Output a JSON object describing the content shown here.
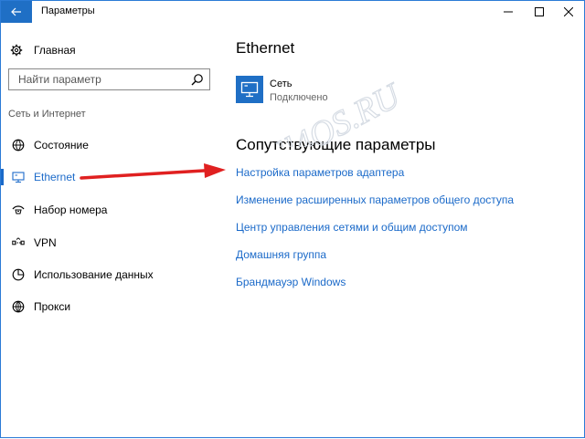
{
  "window": {
    "title": "Параметры",
    "accent": "#1f6fc5",
    "link_color": "#1b6ac9"
  },
  "titlebar": {
    "back_icon": "back-arrow-icon",
    "minimize_icon": "minimize-icon",
    "maximize_icon": "maximize-icon",
    "close_icon": "close-icon"
  },
  "sidebar": {
    "home_label": "Главная",
    "search_placeholder": "Найти параметр",
    "section_label": "Сеть и Интернет",
    "items": [
      {
        "label": "Состояние",
        "icon": "globe-status-icon",
        "active": false
      },
      {
        "label": "Ethernet",
        "icon": "ethernet-icon",
        "active": true
      },
      {
        "label": "Набор номера",
        "icon": "dialup-icon",
        "active": false
      },
      {
        "label": "VPN",
        "icon": "vpn-icon",
        "active": false
      },
      {
        "label": "Использование данных",
        "icon": "data-usage-icon",
        "active": false
      },
      {
        "label": "Прокси",
        "icon": "globe-icon",
        "active": false
      }
    ]
  },
  "main": {
    "heading": "Ethernet",
    "network": {
      "name": "Сеть",
      "status": "Подключено",
      "icon": "network-monitor-icon"
    },
    "related_heading": "Сопутствующие параметры",
    "links": [
      "Настройка параметров адаптера",
      "Изменение расширенных параметров общего доступа",
      "Центр управления сетями и общим доступом",
      "Домашняя группа",
      "Брандмауэр Windows"
    ]
  },
  "watermark": {
    "text": "All4OS.RU"
  }
}
